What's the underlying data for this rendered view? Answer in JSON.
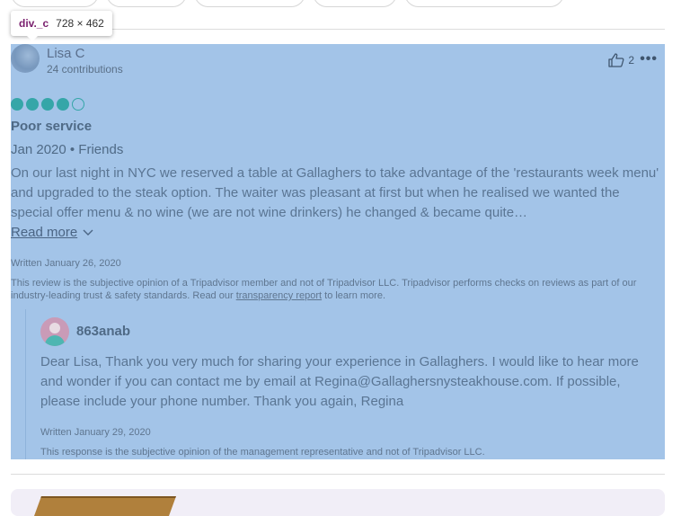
{
  "tooltip": {
    "tag": "div._c",
    "dimensions": "728 × 462"
  },
  "review": {
    "user_name": "Lisa C",
    "contributions": "24 contributions",
    "likes": "2",
    "rating": 4,
    "rating_max": 5,
    "title": "Poor service",
    "meta": "Jan 2020 • Friends",
    "body": "On our last night in NYC we reserved a table at Gallaghers to take advantage of the 'restaurants week menu' and upgraded to the steak option. The waiter was pleasant at first but when he realised we wanted the special offer menu & no wine (we are not wine drinkers) he changed & became quite…",
    "read_more": "Read more",
    "written": "Written January 26, 2020",
    "disclaimer_pre": "This review is the subjective opinion of a Tripadvisor member and not of Tripadvisor LLC. Tripadvisor performs checks on reviews as part of our industry-leading trust & safety standards. Read our ",
    "disclaimer_link": "transparency report",
    "disclaimer_post": " to learn more."
  },
  "response": {
    "user_name": "863anab",
    "body": "Dear Lisa, Thank you very much for sharing your experience in Gallaghers. I would like to hear more and wonder if you can contact me by email at Regina@Gallaghersnysteakhouse.com. If possible, please include your phone number. Thank you again, Regina",
    "written": "Written January 29, 2020",
    "disclaimer": "This response is the subjective opinion of the management representative and not of Tripadvisor LLC."
  },
  "icons": {
    "like": "thumbs-up-icon",
    "more": "more-options-icon",
    "read_more": "chevron-down-icon"
  },
  "colors": {
    "highlight": "#a3c4e8",
    "bubble": "#35a6a8",
    "tooltip_tag": "#7a1f6e"
  }
}
